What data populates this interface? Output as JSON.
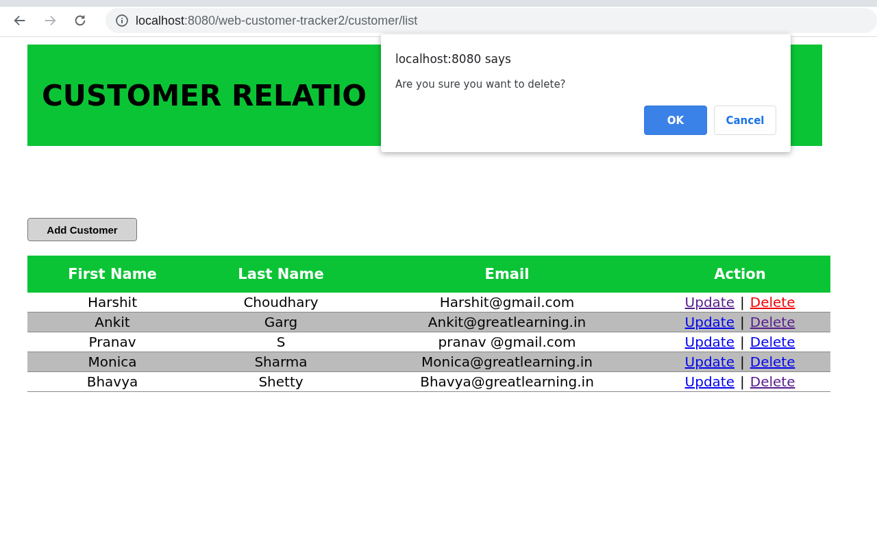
{
  "browser": {
    "url_host": "localhost",
    "url_path": ":8080/web-customer-tracker2/customer/list"
  },
  "header": {
    "title": "CUSTOMER RELATIO"
  },
  "add_button": "Add Customer",
  "table": {
    "columns": [
      "First Name",
      "Last Name",
      "Email",
      "Action"
    ],
    "rows": [
      {
        "cells": [
          "Harshit",
          "Choudhary",
          "Harshit@gmail.com"
        ],
        "update": {
          "label": "Update",
          "visited": true,
          "active": false
        },
        "separator": "|",
        "delete": {
          "label": "Delete",
          "visited": false,
          "active": true
        }
      },
      {
        "cells": [
          "Ankit",
          "Garg",
          "Ankit@greatlearning.in"
        ],
        "update": {
          "label": "Update",
          "visited": false,
          "active": false
        },
        "separator": "|",
        "delete": {
          "label": "Delete",
          "visited": true,
          "active": false
        }
      },
      {
        "cells": [
          "Pranav",
          "S",
          "pranav @gmail.com"
        ],
        "update": {
          "label": "Update",
          "visited": false,
          "active": false
        },
        "separator": "|",
        "delete": {
          "label": "Delete",
          "visited": false,
          "active": false
        }
      },
      {
        "cells": [
          "Monica",
          "Sharma",
          "Monica@greatlearning.in"
        ],
        "update": {
          "label": "Update",
          "visited": false,
          "active": false
        },
        "separator": "|",
        "delete": {
          "label": "Delete",
          "visited": false,
          "active": false
        }
      },
      {
        "cells": [
          "Bhavya",
          "Shetty",
          "Bhavya@greatlearning.in"
        ],
        "update": {
          "label": "Update",
          "visited": false,
          "active": false
        },
        "separator": "|",
        "delete": {
          "label": "Delete",
          "visited": true,
          "active": false
        }
      }
    ]
  },
  "dialog": {
    "title": "localhost:8080 says",
    "message": "Are you sure you want to delete?",
    "buttons": [
      {
        "label": "OK",
        "kind": "primary"
      },
      {
        "label": "Cancel",
        "kind": "secondary"
      }
    ]
  }
}
